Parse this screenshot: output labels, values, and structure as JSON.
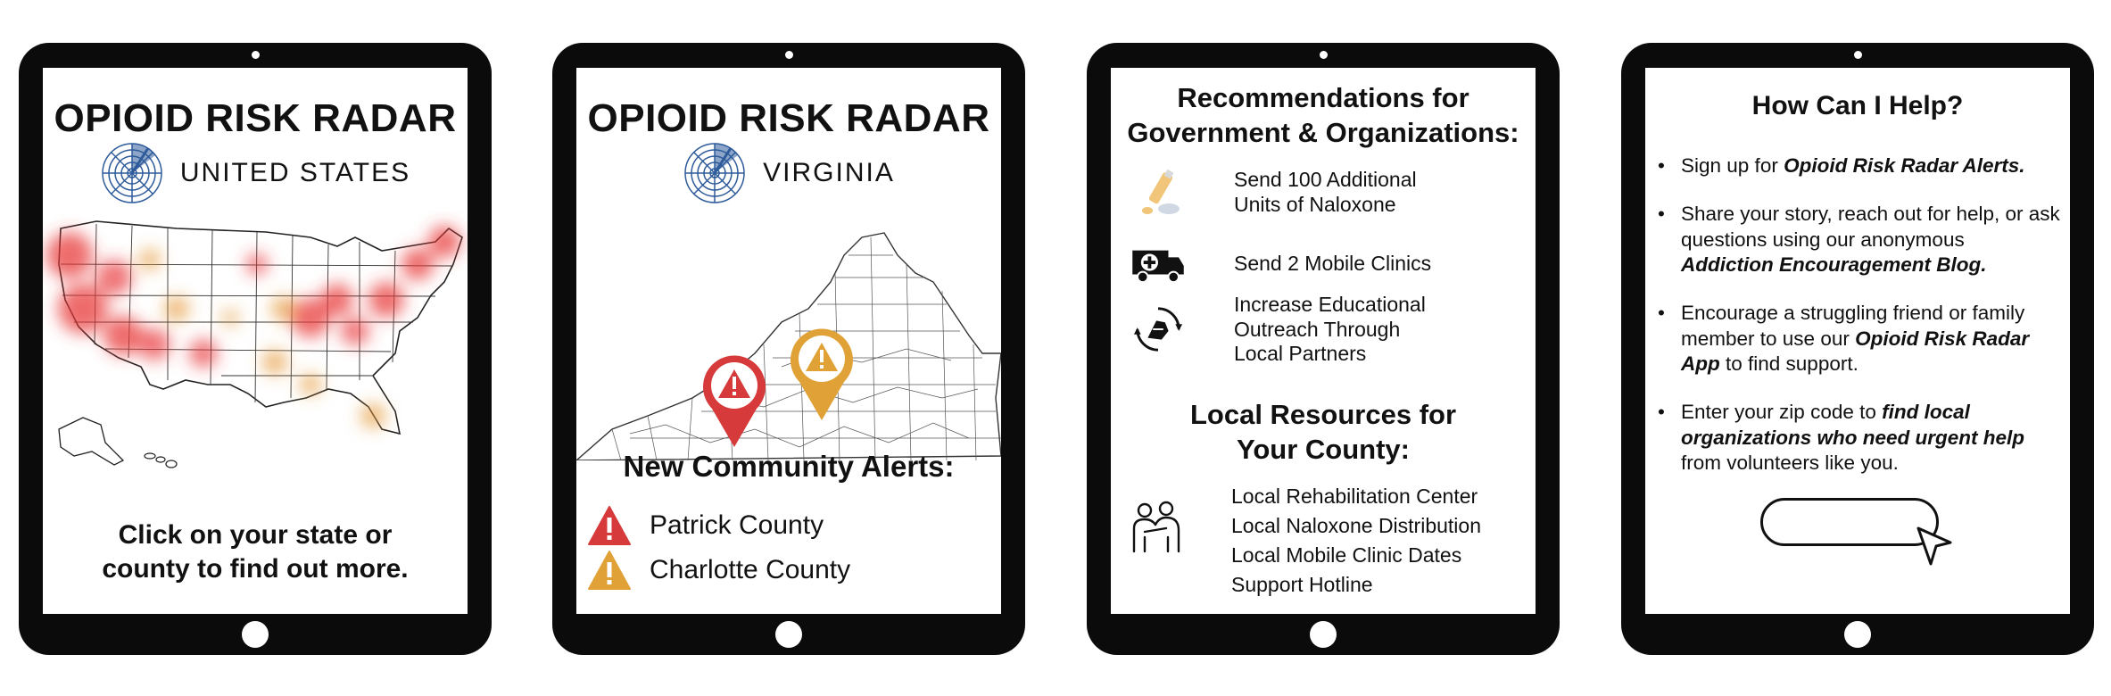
{
  "tablets": [
    {
      "app_title": "OPIOID RISK RADAR",
      "region": "UNITED STATES",
      "cta": [
        "Click on your state or",
        "county to find out more."
      ]
    },
    {
      "app_title": "OPIOID RISK RADAR",
      "region": "VIRGINIA",
      "alerts_title": "New Community Alerts:",
      "alerts": [
        {
          "county": "Patrick County",
          "color": "#d63a3a",
          "icon": "warning-triangle-icon"
        },
        {
          "county": "Charlotte County",
          "color": "#e0a136",
          "icon": "warning-triangle-icon"
        }
      ]
    },
    {
      "recommendations_title": [
        "Recommendations for",
        "Government & Organizations:"
      ],
      "recommendations": [
        {
          "icon": "naloxone-icon",
          "lines": [
            "Send 100 Additional",
            "Units of Naloxone"
          ]
        },
        {
          "icon": "ambulance-icon",
          "lines": [
            "Send 2 Mobile Clinics"
          ]
        },
        {
          "icon": "outreach-icon",
          "lines": [
            "Increase Educational",
            "Outreach Through",
            "Local Partners"
          ]
        }
      ],
      "resources_title": [
        "Local Resources for",
        "Your County:"
      ],
      "resources": [
        "Local Rehabilitation Center",
        "Local Naloxone Distribution",
        "Local Mobile Clinic Dates",
        "Support Hotline"
      ]
    },
    {
      "help_title": "How Can I Help?",
      "help_items": [
        {
          "pre": "Sign up for ",
          "bold": "Opioid Risk Radar Alerts.",
          "post": ""
        },
        {
          "pre": "Share your story, reach out for help, or ask questions using our anonymous ",
          "bold": "Addiction Encouragement Blog.",
          "post": ""
        },
        {
          "pre": "Encourage a struggling friend or family member to use our ",
          "bold": "Opioid Risk Radar App",
          "post": " to find support."
        },
        {
          "pre": "Enter your zip code to ",
          "bold": "find local organizations who need urgent help",
          "post": " from volunteers like you."
        }
      ],
      "zip_input_value": ""
    }
  ],
  "colors": {
    "alert_red": "#d63a3a",
    "alert_orange": "#e0a136",
    "radar_blue": "#2e5b9a",
    "tablet_frame": "#0b0b0b"
  }
}
